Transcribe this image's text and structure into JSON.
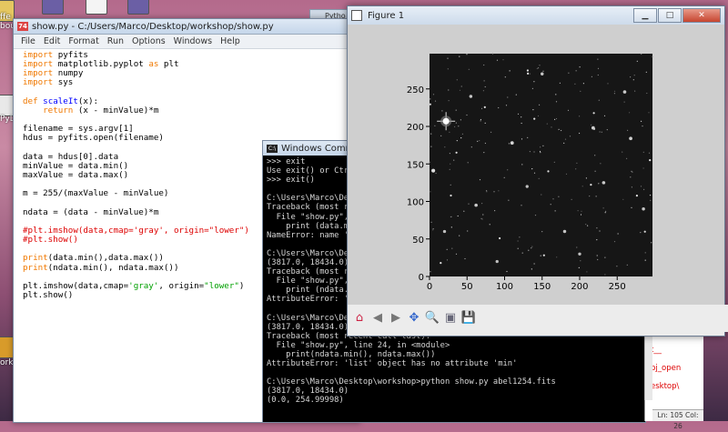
{
  "desktop": {
    "icons": [
      {
        "label": "ffe",
        "label2": "bou"
      },
      {
        "label": "PyL"
      },
      {
        "label": "orksh"
      }
    ]
  },
  "editor": {
    "title": "show.py - C:/Users/Marco/Desktop/workshop/show.py",
    "badge": "74",
    "menu": [
      "File",
      "Edit",
      "Format",
      "Run",
      "Options",
      "Windows",
      "Help"
    ]
  },
  "behind_tab": {
    "label": "Pytho"
  },
  "cmd": {
    "title": "Windows Command P",
    "lines": [
      ">>> exit",
      "Use exit() or Ctrl-Z plus Return to exit",
      ">>> exit()",
      "",
      "C:\\Users\\Marco\\Desktop\\workshop>python show.py abel1254.fits",
      "Traceback (most recent call last):",
      "  File \"show.py\", line 20, in <module>",
      "    print (data.min(), data.max())",
      "NameError: name 'data' is not defined",
      "",
      "C:\\Users\\Marco\\Desktop\\workshop>python show.py abel1254.fits",
      "(3817.0, 18434.0)",
      "Traceback (most recent call last):",
      "  File \"show.py\", line 24, in <module>",
      "    print (ndata.min(), ndata.max())",
      "AttributeError: 'list' object has no attribute 'min'",
      "",
      "C:\\Users\\Marco\\Desktop\\workshop>python show.py abel1254.fits",
      "(3817.0, 18434.0)",
      "Traceback (most recent call last):",
      "  File \"show.py\", line 24, in <module>",
      "    print(ndata.min(), ndata.max())",
      "AttributeError: 'list' object has no attribute 'min'",
      "",
      "C:\\Users\\Marco\\Desktop\\workshop>python show.py abel1254.fits",
      "(3817.0, 18434.0)",
      "(0.0, 254.99998)"
    ]
  },
  "rightwin": {
    "lines": [
      "t__",
      "bj_open",
      "esktop\\"
    ],
    "status": "Ln: 105 Col: 26"
  },
  "figure": {
    "title": "Figure 1",
    "buttons": {
      "minimize": "▁",
      "maximize": "□",
      "close": "✕"
    },
    "toolbar_icons": [
      "home-icon",
      "back-icon",
      "forward-icon",
      "pan-icon",
      "zoom-icon",
      "subplots-icon",
      "save-icon"
    ],
    "toolbar_glyphs": [
      "⌂",
      "◀",
      "▶",
      "✥",
      "🔍",
      "▣",
      "💾"
    ]
  },
  "chart_data": {
    "type": "heatmap",
    "colormap": "gray",
    "origin": "lower",
    "xlim": [
      0,
      297
    ],
    "ylim": [
      0,
      297
    ],
    "xticks": [
      0,
      50,
      100,
      150,
      200,
      250
    ],
    "yticks": [
      0,
      50,
      100,
      150,
      200,
      250
    ],
    "bright_stars": [
      {
        "x": 22,
        "y": 207,
        "brightness": 1.0,
        "spikes": true
      },
      {
        "x": 5,
        "y": 141,
        "brightness": 0.7
      },
      {
        "x": 110,
        "y": 178,
        "brightness": 0.6
      },
      {
        "x": 218,
        "y": 198,
        "brightness": 0.55
      },
      {
        "x": 268,
        "y": 184,
        "brightness": 0.55
      },
      {
        "x": 62,
        "y": 95,
        "brightness": 0.5
      },
      {
        "x": 232,
        "y": 125,
        "brightness": 0.5
      },
      {
        "x": 150,
        "y": 270,
        "brightness": 0.45
      },
      {
        "x": 260,
        "y": 246,
        "brightness": 0.5
      },
      {
        "x": 55,
        "y": 240,
        "brightness": 0.45
      },
      {
        "x": 180,
        "y": 60,
        "brightness": 0.45
      },
      {
        "x": 90,
        "y": 20,
        "brightness": 0.4
      },
      {
        "x": 20,
        "y": 60,
        "brightness": 0.4
      },
      {
        "x": 285,
        "y": 90,
        "brightness": 0.45
      },
      {
        "x": 130,
        "y": 120,
        "brightness": 0.4
      },
      {
        "x": 200,
        "y": 30,
        "brightness": 0.4
      }
    ]
  }
}
